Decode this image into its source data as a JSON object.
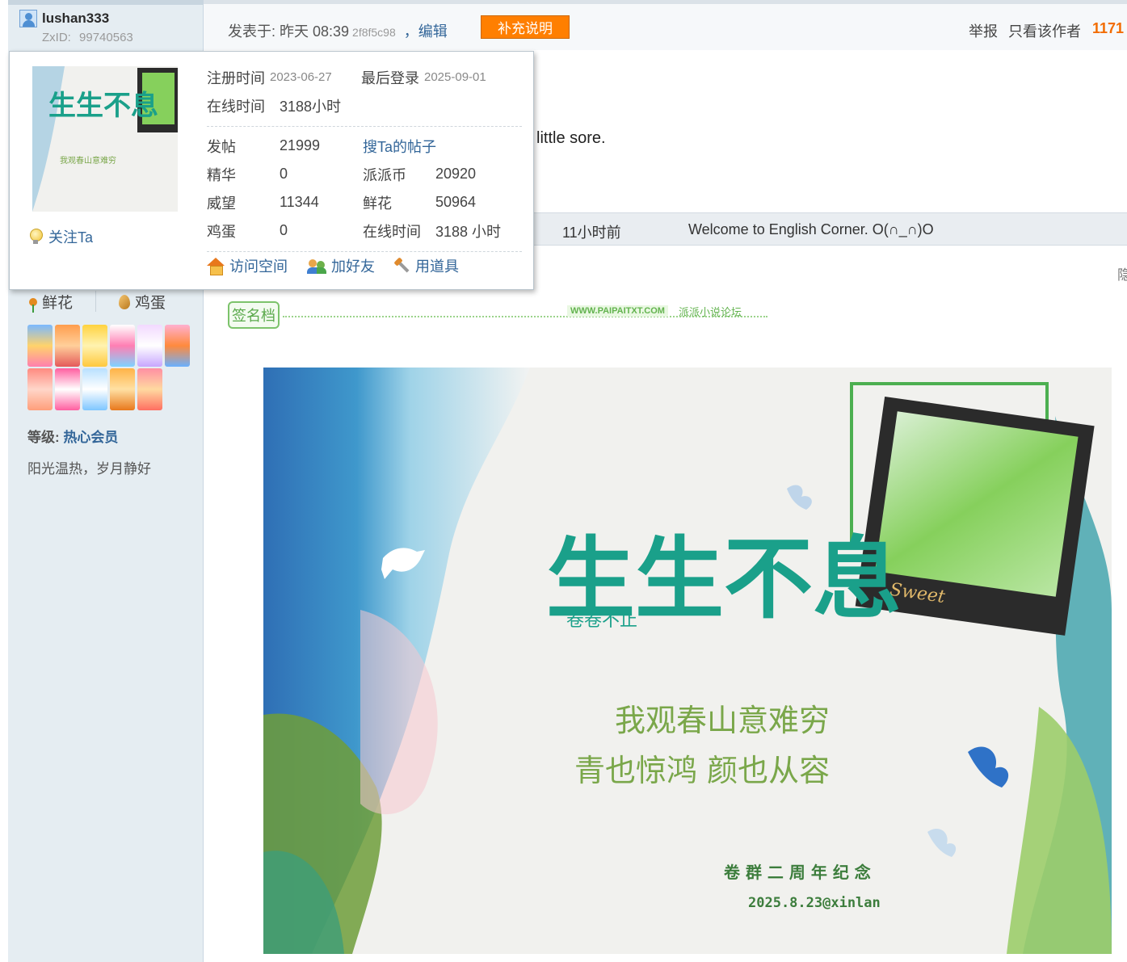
{
  "user": {
    "name": "lushan333",
    "zxid_label": "ZxID:",
    "zxid": "99740563",
    "items": {
      "flower": "鲜花",
      "egg": "鸡蛋"
    },
    "level_label": "等级:",
    "level": "热心会员",
    "motto": "阳光温热，岁月静好",
    "follow": "关注Ta"
  },
  "post": {
    "posted_at": "发表于: 昨天 08:39",
    "hash": "2f8f5c98",
    "edit": "，编辑",
    "supplement": "补充说明",
    "report": "举报",
    "only_author": "只看该作者",
    "floor": "1171",
    "body_fragment": "little sore.",
    "hide": "隐"
  },
  "reply": {
    "time": "11小时前",
    "message": "Welcome to English Corner. O(∩_∩)O"
  },
  "signature": {
    "tag": "签名档",
    "site_url": "WWW.PAIPAITXT.COM",
    "site_name": "派派小说论坛",
    "title_big": "生生不息",
    "subtitle": "卷卷不止",
    "poem_line1": "我观春山意难穷",
    "poem_line2": "青也惊鸿  颜也从容",
    "anniversary": "卷 群 二 周 年 纪 念",
    "credit": "2025.8.23@xinlan",
    "sweet": "Sweet"
  },
  "profile": {
    "reg_label": "注册时间",
    "reg_date": "2023-06-27",
    "last_label": "最后登录",
    "last_date": "2025-09-01",
    "online_label": "在线时间",
    "online_val": "3188小时",
    "posts_label": "发帖",
    "posts": "21999",
    "search_posts": "搜Ta的帖子",
    "digest_label": "精华",
    "digest": "0",
    "coin_label": "派派币",
    "coin": "20920",
    "prestige_label": "威望",
    "prestige": "11344",
    "flower_label": "鲜花",
    "flower": "50964",
    "egg_label": "鸡蛋",
    "egg": "0",
    "online2_label": "在线时间",
    "online2": "3188 小时",
    "visit": "访问空间",
    "add_friend": "加好友",
    "use_tool": "用道具"
  },
  "colors": {
    "accent_orange": "#ff7f00",
    "link_blue": "#336699",
    "sidebar_bg": "#e5edf2",
    "floor_orange": "#f26c00"
  },
  "icons": {
    "user": "user-icon",
    "bulb": "bulb-icon",
    "home": "home-icon",
    "friend": "add-friend-icon",
    "tool": "tool-icon",
    "flower": "flower-icon",
    "egg": "egg-icon"
  }
}
